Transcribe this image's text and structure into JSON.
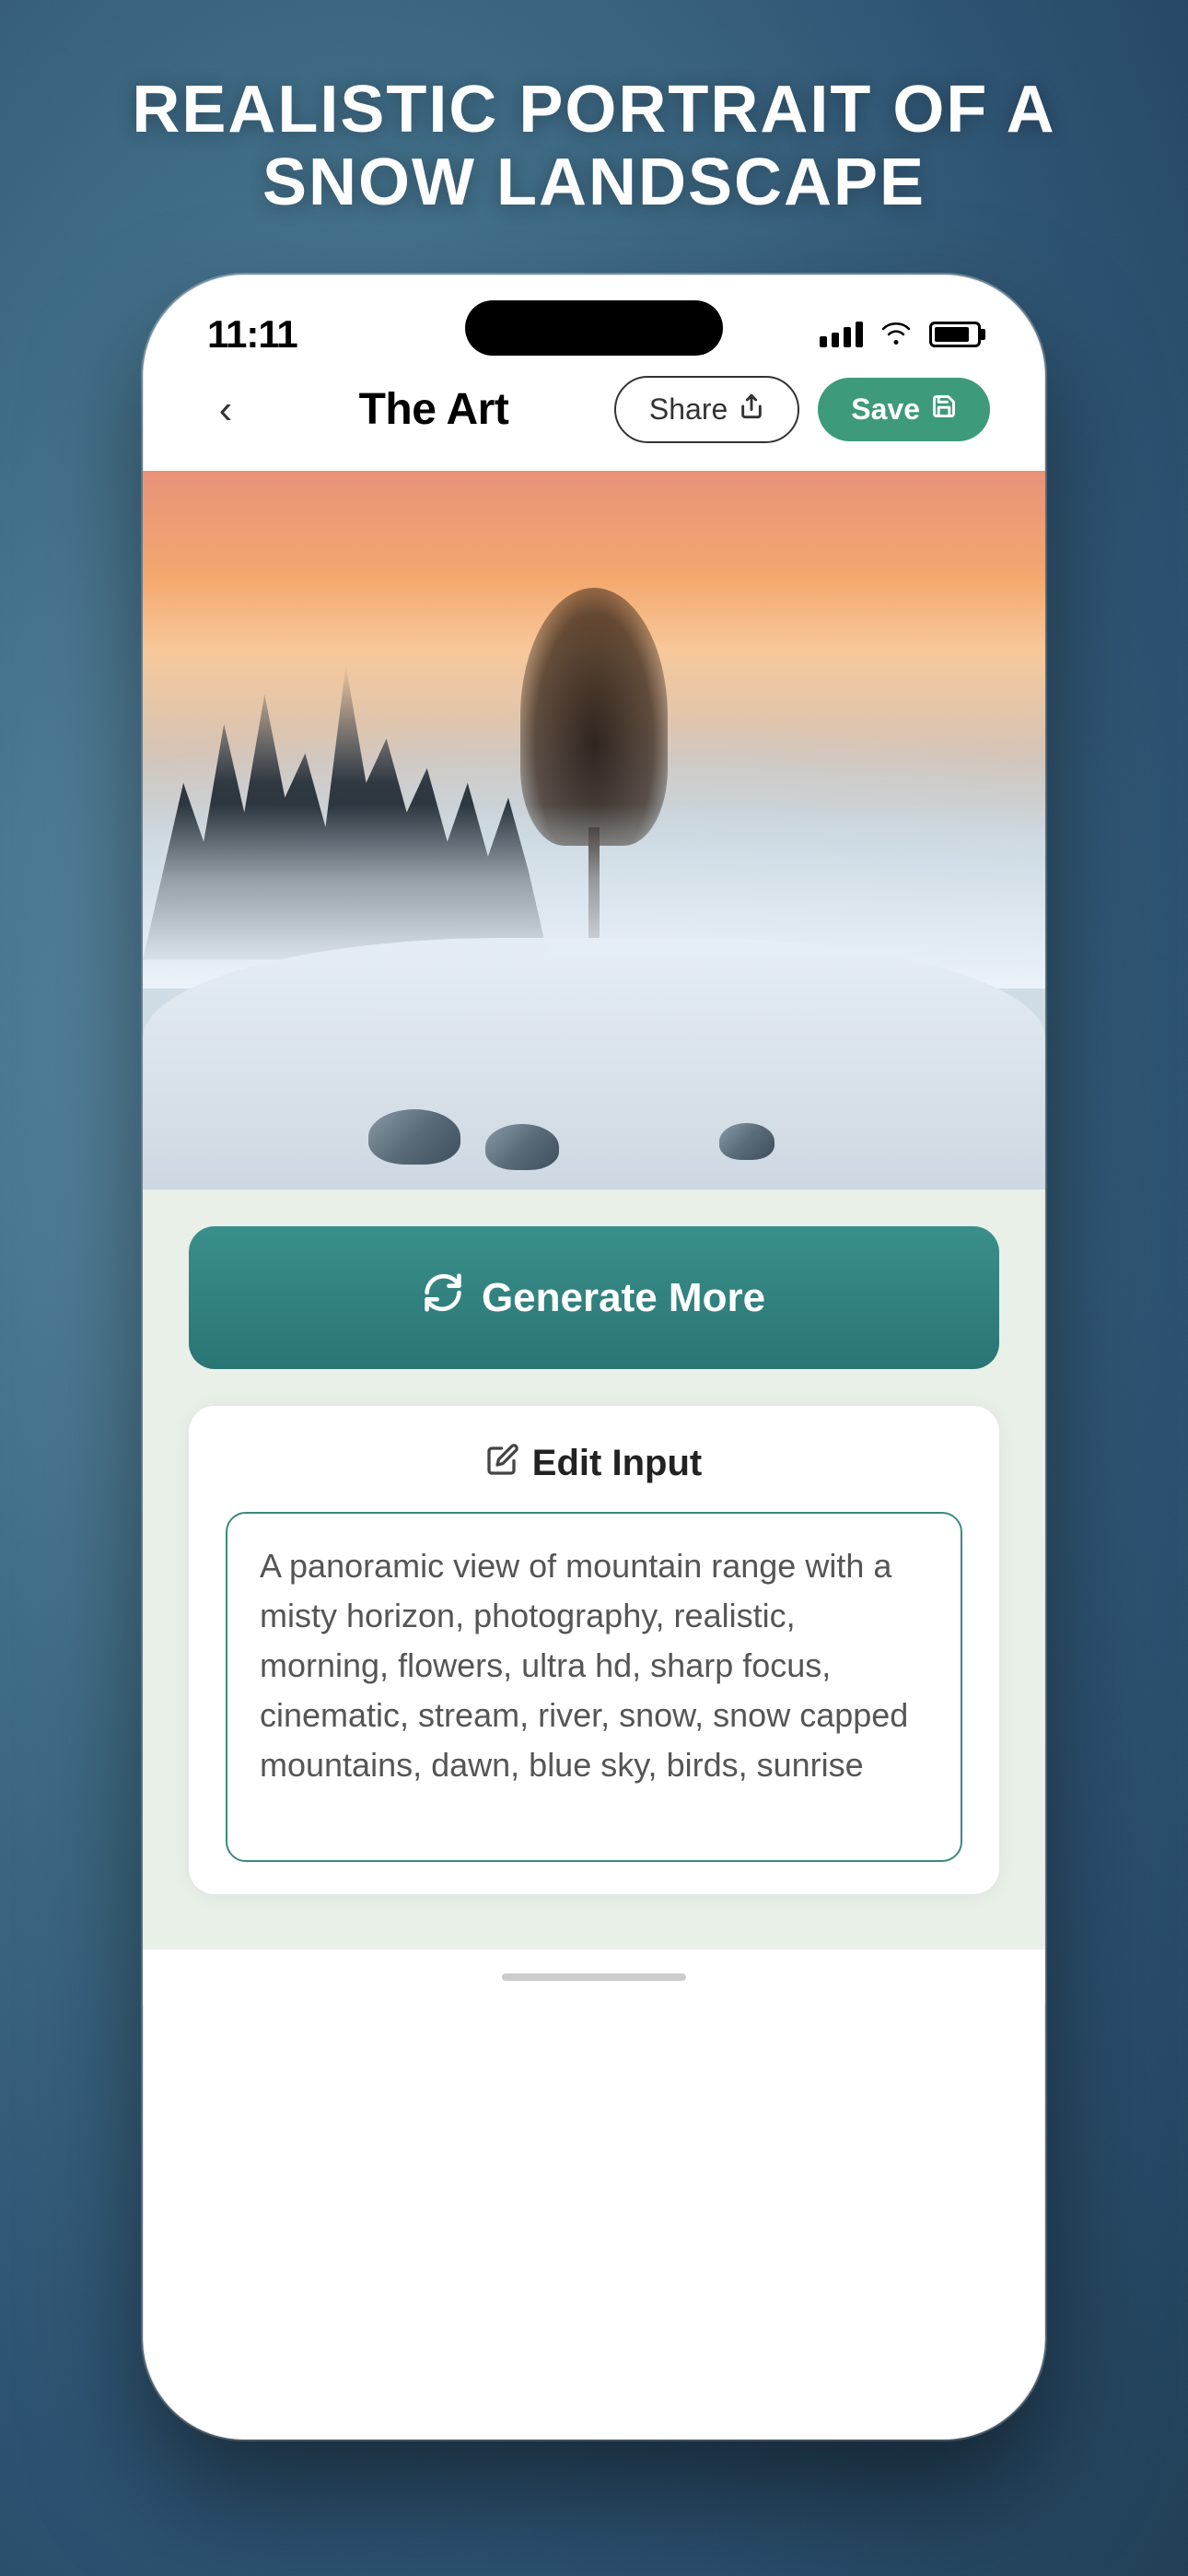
{
  "headline": {
    "title": "REALISTIC PORTRAIT OF A SNOW LANDSCAPE"
  },
  "status_bar": {
    "time": "11:11",
    "wifi": "WiFi",
    "battery": "Full"
  },
  "nav": {
    "title": "The Art",
    "share_label": "Share",
    "save_label": "Save"
  },
  "generate": {
    "button_label": "Generate More",
    "icon": "↻"
  },
  "edit_input": {
    "section_title": "Edit Input",
    "pencil_icon": "✏",
    "textarea_value": "A panoramic view of mountain range with a misty horizon, photography, realistic, morning, flowers, ultra hd, sharp focus, cinematic, stream, river, snow, snow capped mountains, dawn, blue sky, birds, sunrise"
  }
}
